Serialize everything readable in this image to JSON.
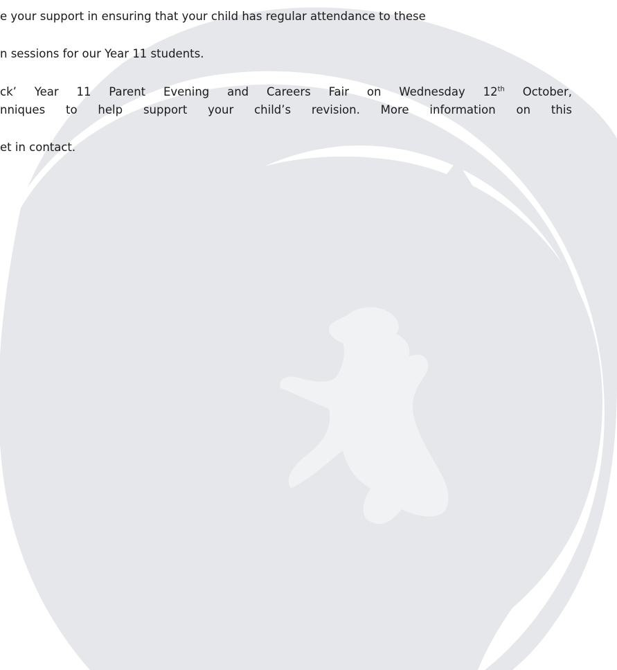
{
  "letter": {
    "line1": "e your support in ensuring that your child has regular attendance to these",
    "line2": "n sessions for our Year 11 students.",
    "line3_a": "ck’ Year 11 Parent Evening and Careers Fair on Wednesday 12",
    "line3_sup": "th",
    "line3_b": " October,",
    "line4": "nniques to help support your child’s revision. More information on this",
    "line5": "et in contact."
  },
  "watermark": {
    "icon": "school-crest-watermark-icon",
    "color": "#e6e7eb",
    "lion_color": "#f1f2f4"
  }
}
